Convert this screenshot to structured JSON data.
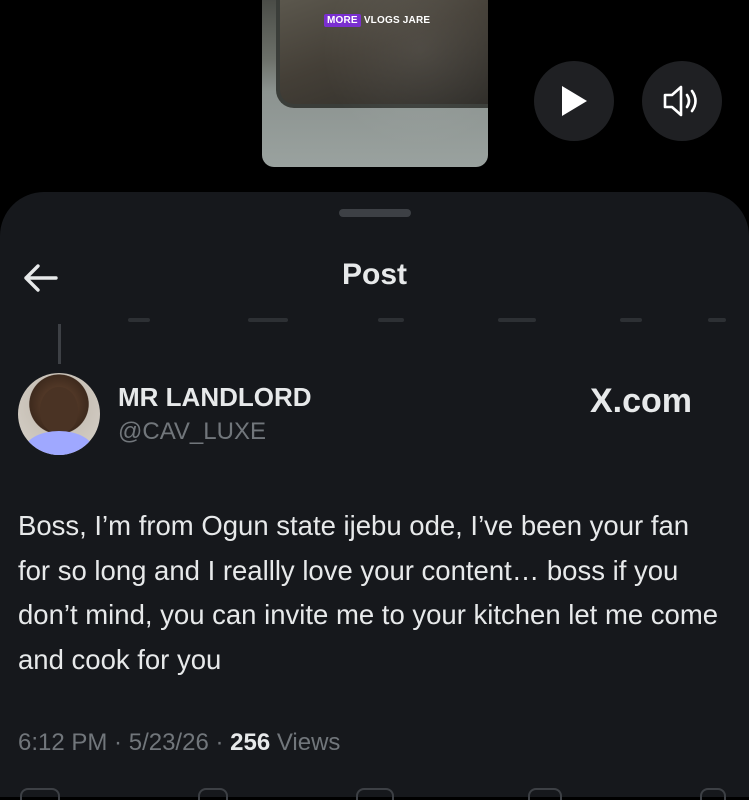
{
  "video": {
    "watermark_more": "MORE",
    "watermark_rest": "VLOGS JARE",
    "play_icon": "play-icon",
    "volume_icon": "volume-icon"
  },
  "header": {
    "title": "Post",
    "back_icon": "back-arrow-icon"
  },
  "post": {
    "author_name": "MR LANDLORD",
    "author_handle": "@CAV_LUXE",
    "brand": "X.com",
    "text": "Boss, I’m from Ogun state ijebu ode, I’ve been your fan for so long and I reallly love your content… boss if you don’t mind, you can invite me to your kitchen let me come and cook for you",
    "time": "6:12 PM",
    "date": "5/23/26",
    "separator": " · ",
    "views_count": "256",
    "views_label": "Views"
  },
  "colors": {
    "background": "#000000",
    "sheet": "#16181c",
    "text": "#e7e9ea",
    "muted": "#71767b",
    "watermark_accent": "#7a2fd0"
  }
}
